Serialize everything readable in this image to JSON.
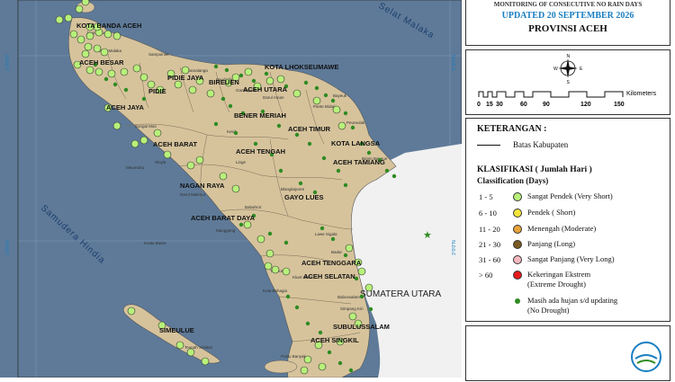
{
  "header": {
    "monitor_title": "MONITORING OF CONSECUTIVE NO RAIN DAYS",
    "updated": "UPDATED 20 SEPTEMBER 2026",
    "province": "PROVINSI ACEH"
  },
  "scale": {
    "unit": "Kilometers",
    "ticks": [
      "0",
      "15",
      "30",
      "60",
      "90",
      "120",
      "150"
    ]
  },
  "legend": {
    "title": "KETERANGAN :",
    "boundary_label": "Batas Kabupaten",
    "class_title": "KLASIFIKASI ( Jumlah Hari )",
    "class_subtitle": "Classification (Days)",
    "classes": [
      {
        "range": "1 - 5",
        "label": "Sangat Pendek (Very Short)",
        "color": "#b7f07a"
      },
      {
        "range": "6 - 10",
        "label": "Pendek ( Short)",
        "color": "#f5e63a"
      },
      {
        "range": "11 - 20",
        "label": "Menengah (Moderate)",
        "color": "#e8a23a"
      },
      {
        "range": "21 - 30",
        "label": "Panjang (Long)",
        "color": "#7a5a22"
      },
      {
        "range": "31 - 60",
        "label": "Sangat Panjang (Very Long)",
        "color": "#f5b8c0"
      },
      {
        "range": "> 60",
        "label": "Kekeringan Ekstrem",
        "label2": "(Extreme Drought)",
        "color": "#e51a1a"
      },
      {
        "range": "",
        "label": "Masih ada hujan s/d updating",
        "label2": "(No Drought)",
        "color": "#2e8b22"
      }
    ]
  },
  "map": {
    "colors": {
      "sea": "#5e7a98",
      "land": "#d6c39c",
      "neighbor": "#f1f1f1"
    },
    "seas": {
      "west": "Samudera Hindia",
      "northeast": "Selat Malaka"
    },
    "neighbor": "SUMATERA UTARA",
    "coords": [
      "5°0'0\"N",
      "5°0'0\"N",
      "3°0'0\"N",
      "3°0'0\"N"
    ],
    "regions": [
      {
        "name": "KOTA BANDA ACEH"
      },
      {
        "name": "ACEH BESAR"
      },
      {
        "name": "PIDIE JAYA"
      },
      {
        "name": "PIDIE"
      },
      {
        "name": "BIREUEN"
      },
      {
        "name": "KOTA LHOKSEUMAWE"
      },
      {
        "name": "ACEH UTARA"
      },
      {
        "name": "ACEH JAYA"
      },
      {
        "name": "BENER MERIAH"
      },
      {
        "name": "ACEH TIMUR"
      },
      {
        "name": "ACEH BARAT"
      },
      {
        "name": "ACEH TENGAH"
      },
      {
        "name": "KOTA LANGSA"
      },
      {
        "name": "ACEH TAMIANG"
      },
      {
        "name": "NAGAN RAYA"
      },
      {
        "name": "GAYO LUES"
      },
      {
        "name": "ACEH BARAT DAYA"
      },
      {
        "name": "ACEH TENGGARA"
      },
      {
        "name": "ACEH SELATAN"
      },
      {
        "name": "SIMEULUE"
      },
      {
        "name": "SUBULUSSALAM"
      },
      {
        "name": "ACEH SINGKIL"
      }
    ],
    "places": [
      "Sampoiniet",
      "Bayeuk",
      "Kuala Batee",
      "Manggeng",
      "Trumon",
      "Peudada",
      "Gandapura",
      "Darul Aman",
      "Samalanga",
      "Pante Bidari",
      "Blangkejeren",
      "Babahrot",
      "Lawe Sigala",
      "Kota Bahagia",
      "Kluet Utara",
      "Simpang Kiri",
      "Teupah Selatan",
      "Pulau Banyak",
      "Sungai Mas",
      "Woyla",
      "Ketol",
      "Linge",
      "Babussalam",
      "Badar",
      "Peureulak",
      "Birem Bayeun",
      "Meureubo",
      "Darul Makmur",
      "Jaya Baru",
      "Kuta Malaka"
    ]
  }
}
